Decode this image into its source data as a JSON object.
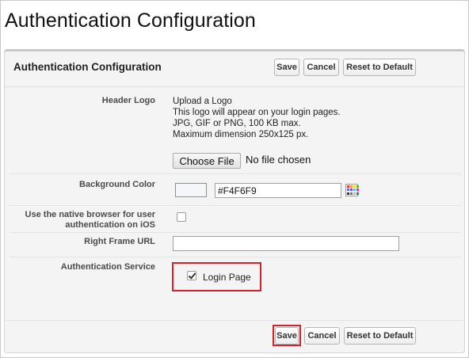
{
  "page": {
    "title": "Authentication Configuration"
  },
  "panel": {
    "title": "Authentication Configuration",
    "buttons": {
      "save": "Save",
      "cancel": "Cancel",
      "reset": "Reset to Default"
    }
  },
  "fields": {
    "header_logo": {
      "label": "Header Logo",
      "lines": [
        "Upload a Logo",
        "This logo will appear on your login pages.",
        "JPG, GIF or PNG, 100 KB max.",
        "Maximum dimension 250x125 px."
      ],
      "choose_file_label": "Choose File",
      "file_status": "No file chosen"
    },
    "background_color": {
      "label": "Background Color",
      "value": "#F4F6F9",
      "swatch_color": "#F4F6F9"
    },
    "native_browser": {
      "label_line1": "Use the native browser for user",
      "label_line2": "authentication on iOS",
      "checked": false
    },
    "right_frame_url": {
      "label": "Right Frame URL",
      "value": ""
    },
    "authentication_service": {
      "label": "Authentication Service",
      "option_label": "Login Page",
      "checked": true
    }
  },
  "colors": {
    "highlight": "#d6202a",
    "panel_background": "#f4f4f4"
  },
  "icons": {
    "color_picker": "color-picker-grid-icon",
    "checkmark": "checkmark-icon"
  }
}
